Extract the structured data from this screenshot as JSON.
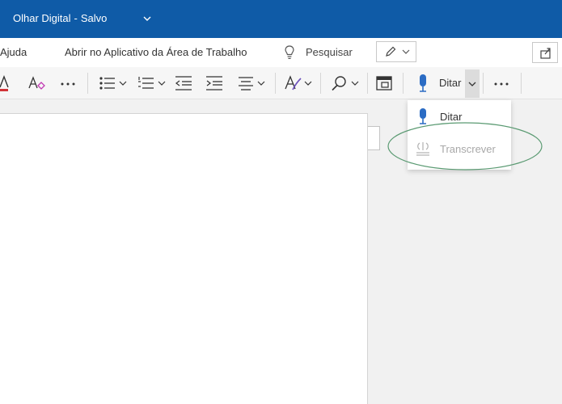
{
  "colors": {
    "brand": "#0f5ba7",
    "icon_blue": "#2b6cc4",
    "font_red": "#d13438",
    "annotation_green": "#5a9a72"
  },
  "title_bar": {
    "doc_name": "Olhar Digital",
    "separator": "-",
    "save_status": "Salvo",
    "chevron_icon": "chevron-down-icon"
  },
  "menu": {
    "help_label": "Ajuda",
    "open_desktop_label": "Abrir no Aplicativo da Área de Trabalho",
    "search_label": "Pesquisar",
    "search_icon": "lightbulb-icon",
    "edit_mode_icon": "pencil-icon",
    "share_icon": "share-icon"
  },
  "toolbar": {
    "icons": [
      "font-color-icon",
      "clear-formatting-icon",
      "more-icon",
      "bullets-icon",
      "numbering-icon",
      "decrease-indent-icon",
      "increase-indent-icon",
      "align-icon",
      "styles-icon",
      "find-icon",
      "immersive-reader-icon",
      "microphone-icon",
      "more-icon"
    ],
    "dictate_label": "Ditar"
  },
  "dropdown": {
    "items": [
      {
        "label": "Ditar",
        "icon": "microphone-icon",
        "enabled": true
      },
      {
        "label": "Transcrever",
        "icon": "transcribe-icon",
        "enabled": false
      }
    ]
  }
}
